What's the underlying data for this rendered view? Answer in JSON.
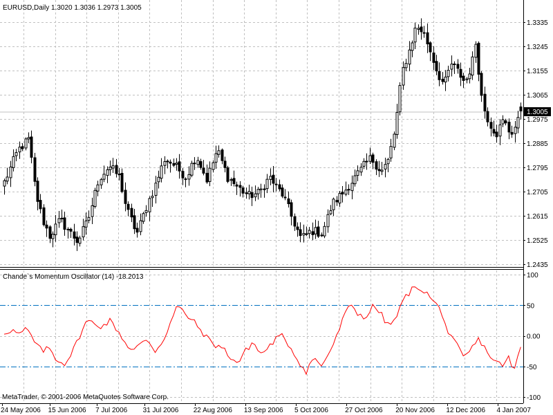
{
  "window": {
    "symbol_header": "EURUSD,Daily  1.3020 1.3036 1.2973 1.3005",
    "copyright": "MetaTrader, © 2001-2006 MetaQuotes Software Corp."
  },
  "colors": {
    "background": "#ffffff",
    "grid": "#c0c0c0",
    "candle": "#000000",
    "oscillator_line": "#ff0000",
    "level_lines": "#0070c0",
    "bid_line": "#c0c0c0"
  },
  "chart_data": [
    {
      "type": "candlestick",
      "title": "EURUSD,Daily  1.3020 1.3036 1.2973 1.3005",
      "symbol": "EURUSD",
      "timeframe": "Daily",
      "last_bar": {
        "open": 1.302,
        "high": 1.3036,
        "low": 1.2973,
        "close": 1.3005
      },
      "current_price_label": "1.3005",
      "current_price": 1.3005,
      "ylim": [
        1.2435,
        1.338
      ],
      "y_ticks": [
        1.3335,
        1.3245,
        1.3155,
        1.3065,
        1.2975,
        1.2885,
        1.2795,
        1.2705,
        1.2615,
        1.2525,
        1.2435
      ],
      "y_tick_labels": [
        "1.3335",
        "1.3245",
        "1.3155",
        "1.3065",
        "1.2975",
        "1.2885",
        "1.2795",
        "1.2705",
        "1.2615",
        "1.2525",
        "1.2435"
      ],
      "grid": true,
      "close_keyframes": [
        [
          0,
          1.274
        ],
        [
          4,
          1.286
        ],
        [
          7,
          1.29
        ],
        [
          9,
          1.27
        ],
        [
          11,
          1.26
        ],
        [
          13,
          1.254
        ],
        [
          16,
          1.26
        ],
        [
          19,
          1.255
        ],
        [
          21,
          1.252
        ],
        [
          24,
          1.26
        ],
        [
          27,
          1.275
        ],
        [
          30,
          1.28
        ],
        [
          33,
          1.276
        ],
        [
          35,
          1.264
        ],
        [
          38,
          1.255
        ],
        [
          41,
          1.266
        ],
        [
          43,
          1.272
        ],
        [
          46,
          1.283
        ],
        [
          49,
          1.28
        ],
        [
          52,
          1.276
        ],
        [
          55,
          1.284
        ],
        [
          58,
          1.275
        ],
        [
          61,
          1.286
        ],
        [
          64,
          1.276
        ],
        [
          67,
          1.272
        ],
        [
          70,
          1.269
        ],
        [
          73,
          1.27
        ],
        [
          76,
          1.276
        ],
        [
          78,
          1.272
        ],
        [
          80,
          1.269
        ],
        [
          82,
          1.262
        ],
        [
          85,
          1.253
        ],
        [
          88,
          1.256
        ],
        [
          91,
          1.255
        ],
        [
          94,
          1.266
        ],
        [
          97,
          1.27
        ],
        [
          100,
          1.275
        ],
        [
          103,
          1.28
        ],
        [
          105,
          1.283
        ],
        [
          108,
          1.278
        ],
        [
          110,
          1.282
        ],
        [
          112,
          1.294
        ],
        [
          114,
          1.315
        ],
        [
          116,
          1.323
        ],
        [
          118,
          1.332
        ],
        [
          120,
          1.33
        ],
        [
          122,
          1.323
        ],
        [
          124,
          1.315
        ],
        [
          126,
          1.31
        ],
        [
          128,
          1.318
        ],
        [
          130,
          1.315
        ],
        [
          132,
          1.311
        ],
        [
          134,
          1.318
        ],
        [
          135,
          1.326
        ],
        [
          137,
          1.303
        ],
        [
          139,
          1.296
        ],
        [
          141,
          1.292
        ],
        [
          143,
          1.297
        ],
        [
          145,
          1.292
        ],
        [
          147,
          1.296
        ],
        [
          148,
          1.3005
        ]
      ],
      "x_tick_labels": [
        {
          "bar": 0,
          "label": "24 May 2006"
        },
        {
          "bar": 15,
          "label": "15 Jun 2006"
        },
        {
          "bar": 30,
          "label": "7 Jul 2006"
        },
        {
          "bar": 45,
          "label": "31 Jul 2006"
        },
        {
          "bar": 61,
          "label": "22 Aug 2006"
        },
        {
          "bar": 77,
          "label": "13 Sep 2006"
        },
        {
          "bar": 93,
          "label": "5 Oct 2006"
        },
        {
          "bar": 109,
          "label": "27 Oct 2006"
        },
        {
          "bar": 125,
          "label": "20 Nov 2006"
        },
        {
          "bar": 141,
          "label": "12 Dec 2006"
        },
        {
          "bar": 157,
          "label": "4 Jan 2007"
        }
      ]
    },
    {
      "type": "line",
      "title": "Chande`s Momentum Oscillator (14) -18.2013",
      "series": [
        {
          "name": "Chande`s Momentum Oscillator (14)",
          "last_value": -18.2013,
          "keyframes": [
            [
              0,
              5
            ],
            [
              2,
              10
            ],
            [
              4,
              2
            ],
            [
              6,
              12
            ],
            [
              8,
              -10
            ],
            [
              10,
              -25
            ],
            [
              12,
              -20
            ],
            [
              14,
              -40
            ],
            [
              16,
              -45
            ],
            [
              18,
              -28
            ],
            [
              20,
              0
            ],
            [
              22,
              25
            ],
            [
              24,
              20
            ],
            [
              26,
              15
            ],
            [
              28,
              25
            ],
            [
              30,
              10
            ],
            [
              32,
              -10
            ],
            [
              34,
              -25
            ],
            [
              36,
              -15
            ],
            [
              38,
              -5
            ],
            [
              40,
              -25
            ],
            [
              42,
              -10
            ],
            [
              44,
              20
            ],
            [
              46,
              50
            ],
            [
              48,
              35
            ],
            [
              50,
              25
            ],
            [
              52,
              10
            ],
            [
              54,
              -5
            ],
            [
              56,
              -15
            ],
            [
              58,
              -20
            ],
            [
              60,
              -35
            ],
            [
              62,
              -45
            ],
            [
              64,
              -25
            ],
            [
              66,
              -10
            ],
            [
              68,
              -30
            ],
            [
              70,
              -20
            ],
            [
              72,
              -5
            ],
            [
              74,
              0
            ],
            [
              76,
              -20
            ],
            [
              78,
              -40
            ],
            [
              80,
              -60
            ],
            [
              82,
              -35
            ],
            [
              84,
              -50
            ],
            [
              86,
              -30
            ],
            [
              88,
              -5
            ],
            [
              90,
              30
            ],
            [
              92,
              52
            ],
            [
              94,
              35
            ],
            [
              96,
              30
            ],
            [
              98,
              50
            ],
            [
              100,
              35
            ],
            [
              102,
              15
            ],
            [
              104,
              30
            ],
            [
              106,
              60
            ],
            [
              108,
              75
            ],
            [
              110,
              80
            ],
            [
              112,
              70
            ],
            [
              114,
              55
            ],
            [
              116,
              40
            ],
            [
              118,
              0
            ],
            [
              120,
              -15
            ],
            [
              122,
              -38
            ],
            [
              124,
              -20
            ],
            [
              126,
              -5
            ],
            [
              128,
              -25
            ],
            [
              130,
              -42
            ],
            [
              132,
              -48
            ],
            [
              134,
              -35
            ],
            [
              135,
              -62
            ],
            [
              137,
              -18.2013
            ]
          ]
        }
      ],
      "ylim": [
        -100,
        100
      ],
      "y_ticks": [
        100,
        50,
        0,
        -50,
        -100
      ],
      "y_tick_labels": [
        "100",
        "50",
        "0.00",
        "-50",
        "-100"
      ],
      "levels": [
        50,
        -50
      ],
      "grid": true
    }
  ]
}
